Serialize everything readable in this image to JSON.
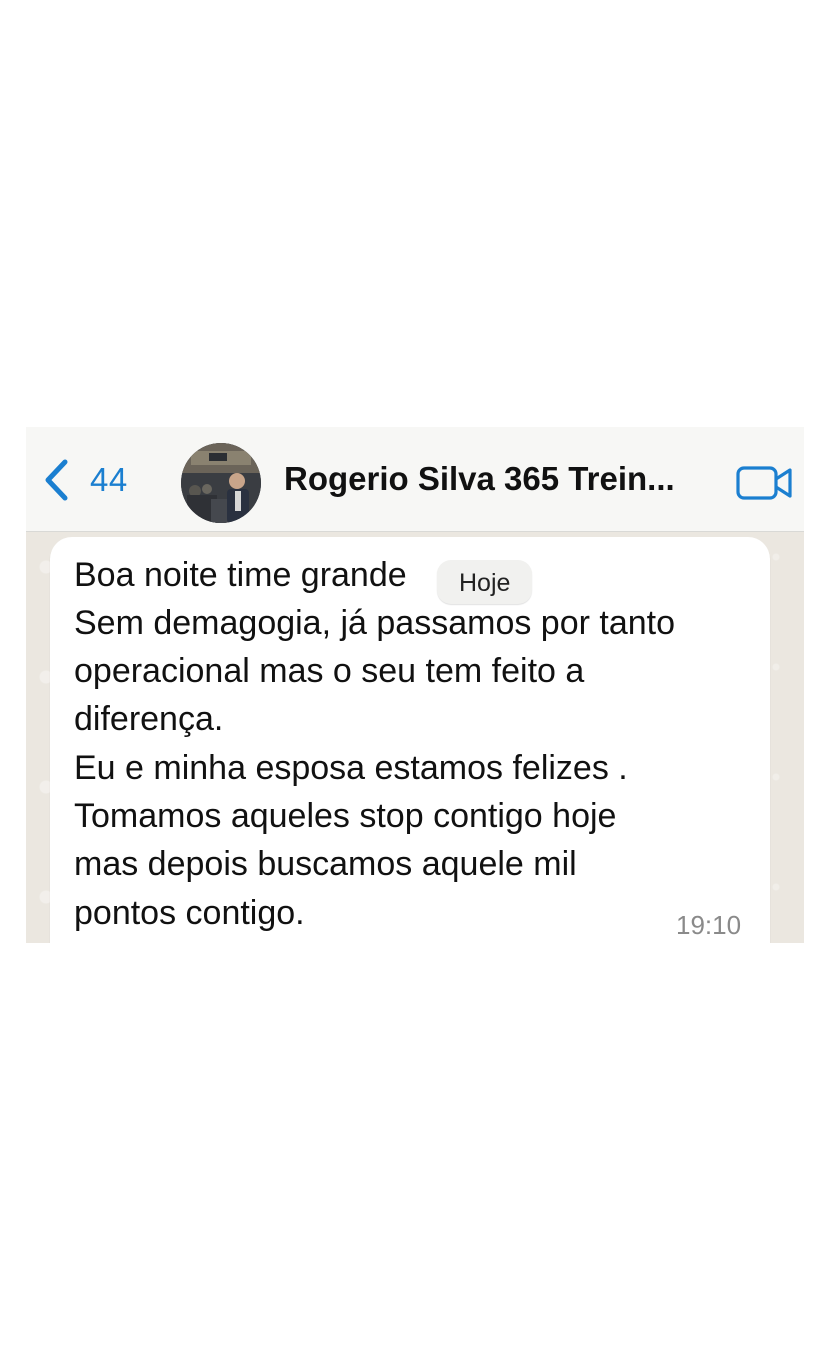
{
  "header": {
    "back_count": "44",
    "contact_name": "Rogerio Silva 365 Trein..."
  },
  "icons": {
    "back": "chevron-left-icon",
    "video": "video-camera-icon",
    "accent": "#1b7fd0"
  },
  "date_chip": "Hoje",
  "message": {
    "lines": [
      "Boa noite time grande",
      "Sem demagogia, já passamos por tanto",
      "operacional mas o seu tem feito a",
      "diferença.",
      "Eu e minha esposa estamos felizes .",
      "Tomamos aqueles stop contigo hoje",
      "mas depois buscamos aquele mil",
      "pontos contigo."
    ],
    "time": "19:10"
  }
}
